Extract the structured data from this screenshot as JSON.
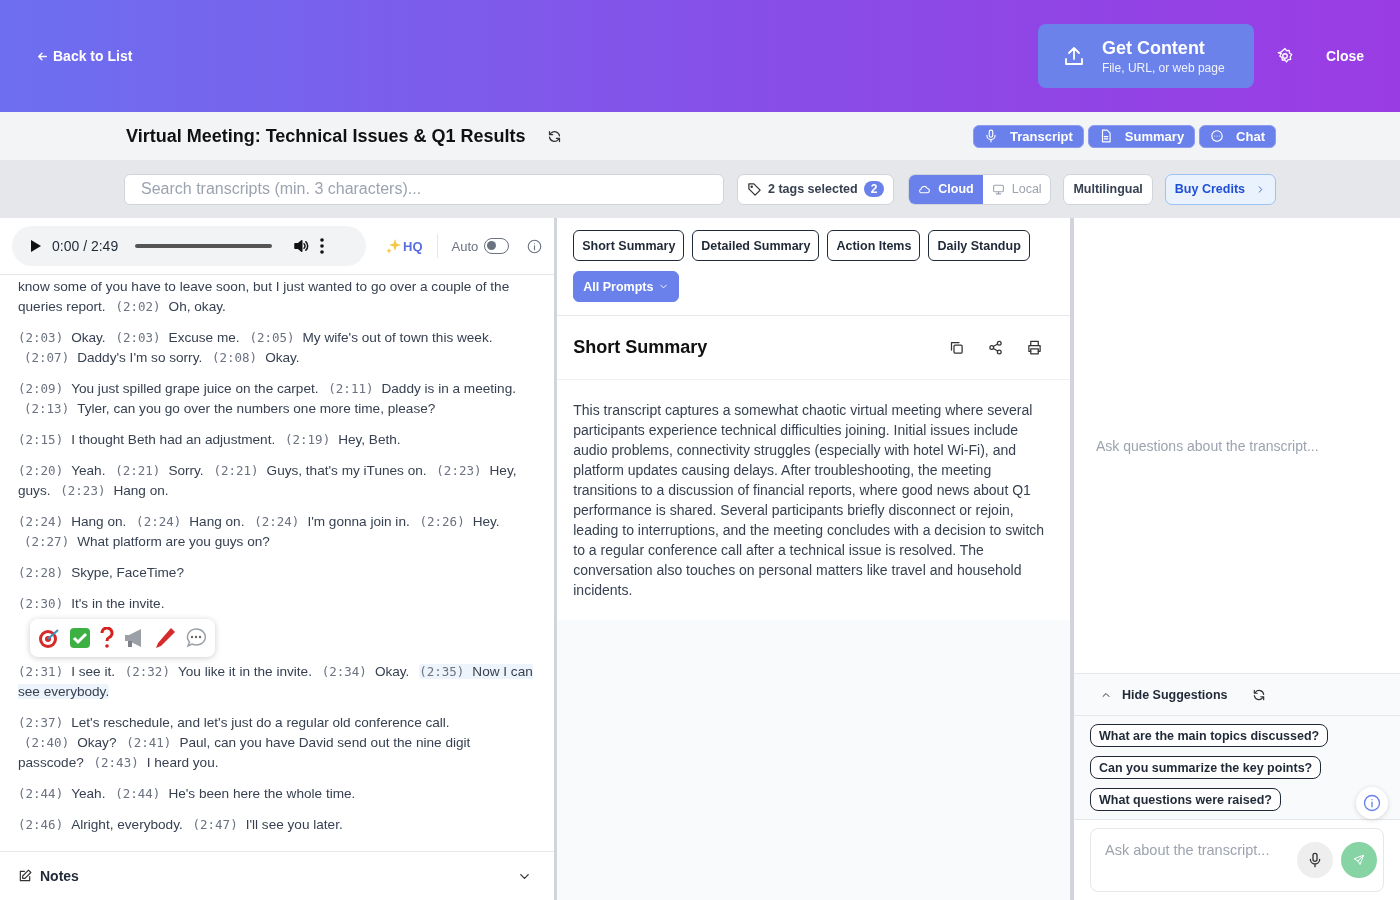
{
  "header": {
    "back": "Back to List",
    "get_content": {
      "title": "Get Content",
      "subtitle": "File, URL, or web page"
    },
    "close": "Close"
  },
  "title_bar": {
    "title": "Virtual Meeting: Technical Issues & Q1 Results",
    "views": [
      {
        "label": "Transcript"
      },
      {
        "label": "Summary"
      },
      {
        "label": "Chat"
      }
    ]
  },
  "toolbar": {
    "search": {
      "placeholder": "Search transcripts (min. 3 characters)..."
    },
    "tags": {
      "label": "2 tags selected",
      "count": "2"
    },
    "modes": [
      {
        "label": "Cloud",
        "selected": true
      },
      {
        "label": "Local",
        "selected": false
      }
    ],
    "multilingual": "Multilingual",
    "buy_credits": "Buy Credits"
  },
  "player": {
    "time": "0:00 / 2:49",
    "level": 0,
    "hq": "HQ",
    "auto": {
      "label": "Auto",
      "on": false
    }
  },
  "transcript": [
    [
      {
        "text": "know some of you have to leave soon, but I just wanted to go over a couple of the queries report.",
        "highlighted": false
      },
      {
        "time": "(2:02)",
        "text": "Oh, okay.",
        "highlighted": false
      }
    ],
    [
      {
        "time": "(2:03)",
        "text": "Okay.",
        "highlighted": false
      },
      {
        "time": "(2:03)",
        "text": "Excuse me.",
        "highlighted": false
      },
      {
        "time": "(2:05)",
        "text": "My wife's out of town this week.",
        "highlighted": false
      },
      {
        "time": "(2:07)",
        "text": "Daddy's I'm so sorry.",
        "highlighted": false
      },
      {
        "time": "(2:08)",
        "text": "Okay.",
        "highlighted": false
      }
    ],
    [
      {
        "time": "(2:09)",
        "text": "You just spilled grape juice on the carpet.",
        "highlighted": false
      },
      {
        "time": "(2:11)",
        "text": "Daddy is in a meeting.",
        "highlighted": false
      },
      {
        "time": "(2:13)",
        "text": "Tyler, can you go over the numbers one more time, please?",
        "highlighted": false
      }
    ],
    [
      {
        "time": "(2:15)",
        "text": "I thought Beth had an adjustment.",
        "highlighted": false
      },
      {
        "time": "(2:19)",
        "text": "Hey, Beth.",
        "highlighted": false
      }
    ],
    [
      {
        "time": "(2:20)",
        "text": "Yeah.",
        "highlighted": false
      },
      {
        "time": "(2:21)",
        "text": "Sorry.",
        "highlighted": false
      },
      {
        "time": "(2:21)",
        "text": "Guys, that's my iTunes on.",
        "highlighted": false
      },
      {
        "time": "(2:23)",
        "text": "Hey, guys.",
        "highlighted": false
      },
      {
        "time": "(2:23)",
        "text": "Hang on.",
        "highlighted": false
      }
    ],
    [
      {
        "time": "(2:24)",
        "text": "Hang on.",
        "highlighted": false
      },
      {
        "time": "(2:24)",
        "text": "Hang on.",
        "highlighted": false
      },
      {
        "time": "(2:24)",
        "text": "I'm gonna join in.",
        "highlighted": false
      },
      {
        "time": "(2:26)",
        "text": "Hey.",
        "highlighted": false
      },
      {
        "time": "(2:27)",
        "text": "What platform are you guys on?",
        "highlighted": false
      }
    ],
    [
      {
        "time": "(2:28)",
        "text": "Skype, FaceTime?",
        "highlighted": false
      }
    ],
    [
      {
        "time": "(2:30)",
        "text": "It's in the invite.",
        "highlighted": false
      }
    ],
    [
      {
        "time": "(2:31)",
        "text": "I see it.",
        "highlighted": false
      },
      {
        "time": "(2:32)",
        "text": "You like it in the invite.",
        "highlighted": false
      },
      {
        "time": "(2:34)",
        "text": "Okay.",
        "highlighted": false
      },
      {
        "time": "(2:35)",
        "text": "Now I can see everybody.",
        "highlighted": true
      }
    ],
    [
      {
        "time": "(2:37)",
        "text": "Let's reschedule, and let's just do a regular old conference call.",
        "highlighted": false
      },
      {
        "time": "(2:40)",
        "text": "Okay?",
        "highlighted": false
      },
      {
        "time": "(2:41)",
        "text": "Paul, can you have David send out the nine digit passcode?",
        "highlighted": false
      },
      {
        "time": "(2:43)",
        "text": "I heard you.",
        "highlighted": false
      }
    ],
    [
      {
        "time": "(2:44)",
        "text": "Yeah.",
        "highlighted": false
      },
      {
        "time": "(2:44)",
        "text": "He's been here the whole time.",
        "highlighted": false
      }
    ],
    [
      {
        "time": "(2:46)",
        "text": "Alright, everybody.",
        "highlighted": false
      },
      {
        "time": "(2:47)",
        "text": "I'll see you later.",
        "highlighted": false
      }
    ]
  ],
  "notes": {
    "label": "Notes"
  },
  "summary": {
    "prompts": [
      "Short Summary",
      "Detailed Summary",
      "Action Items",
      "Daily Standup"
    ],
    "all_prompts": "All Prompts",
    "title": "Short Summary",
    "text": "This transcript captures a somewhat chaotic virtual meeting where several participants experience technical difficulties joining. Initial issues include audio problems, connectivity struggles (especially with hotel Wi-Fi), and platform updates causing delays. After troubleshooting, the meeting transitions to a discussion of financial reports, where good news about Q1 performance is shared. Several participants briefly disconnect or rejoin, leading to interruptions, and the meeting concludes with a decision to switch to a regular conference call after a technical issue is resolved. The conversation also touches on personal matters like travel and household incidents."
  },
  "chat": {
    "empty_hint": "Ask questions about the transcript...",
    "suggestions_toggle": "Hide Suggestions",
    "suggestions": [
      "What are the main topics discussed?",
      "Can you summarize the key points?",
      "What questions were raised?"
    ],
    "input": {
      "placeholder": "Ask about the transcript..."
    }
  }
}
